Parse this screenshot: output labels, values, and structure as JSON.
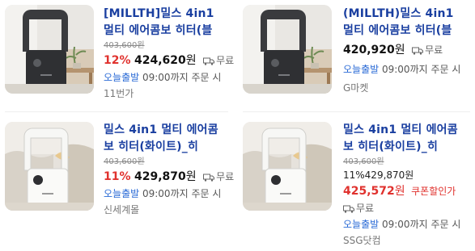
{
  "products": [
    {
      "title": "[MILLTH]밀스 4in1 멀티 에어콤보 히터(블",
      "original_price": "403,600원",
      "discount": "12%",
      "price": "424,620",
      "won": "원",
      "shipping": "무료",
      "delivery_today": "오늘출발",
      "delivery_rest": " 09:00까지 주문 시",
      "seller": "11번가",
      "color": "black"
    },
    {
      "title": "(MILLTH)밀스 4in1 멀티 에어콤보 히터(블",
      "price": "420,920",
      "won": "원",
      "shipping": "무료",
      "delivery_today": "오늘출발",
      "delivery_rest": " 09:00까지 주문 시",
      "seller": "G마켓",
      "color": "black"
    },
    {
      "title": "밀스 4in1 멀티 에어콤보 히터(화이트)_히",
      "original_price": "403,600원",
      "discount": "11%",
      "price": "429,870",
      "won": "원",
      "shipping": "무료",
      "delivery_today": "오늘출발",
      "delivery_rest": " 09:00까지 주문 시",
      "seller": "신세계몰",
      "color": "white"
    },
    {
      "title": "밀스 4in1 멀티 에어콤보 히터(화이트)_히",
      "original_price": "403,600원",
      "discount": "11%",
      "price": "429,870",
      "won": "원",
      "coupon_price": "425,572",
      "coupon_label": "쿠폰할인가",
      "shipping": "무료",
      "delivery_today": "오늘출발",
      "delivery_rest": " 09:00까지 주문 시",
      "seller": "SSG닷컴",
      "color": "white"
    }
  ],
  "colors": {
    "title": "#1a3fa0",
    "discount": "#e0322e",
    "today": "#2a6ad6"
  }
}
